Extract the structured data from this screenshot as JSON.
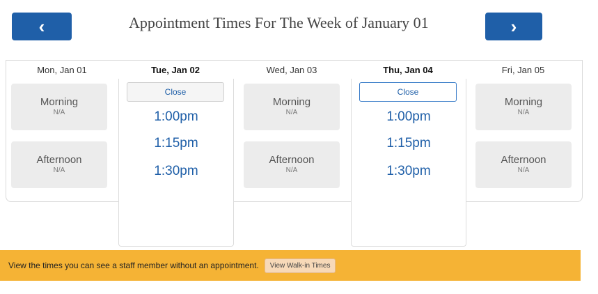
{
  "header": {
    "title": "Appointment Times For The Week of January 01",
    "prev_icon": "‹",
    "next_icon": "›"
  },
  "days": [
    {
      "label": "Mon, Jan 01"
    },
    {
      "label": "Tue, Jan 02"
    },
    {
      "label": "Wed, Jan 03"
    },
    {
      "label": "Thu, Jan 04"
    },
    {
      "label": "Fri, Jan 05"
    }
  ],
  "cards": {
    "morning_label": "Morning",
    "afternoon_label": "Afternoon",
    "na": "N/A"
  },
  "expanded": {
    "close_label": "Close",
    "times": [
      "1:00pm",
      "1:15pm",
      "1:30pm"
    ]
  },
  "walkin": {
    "text": "View the times you can see a staff member without an appointment.",
    "button_label": "View Walk-in Times"
  }
}
